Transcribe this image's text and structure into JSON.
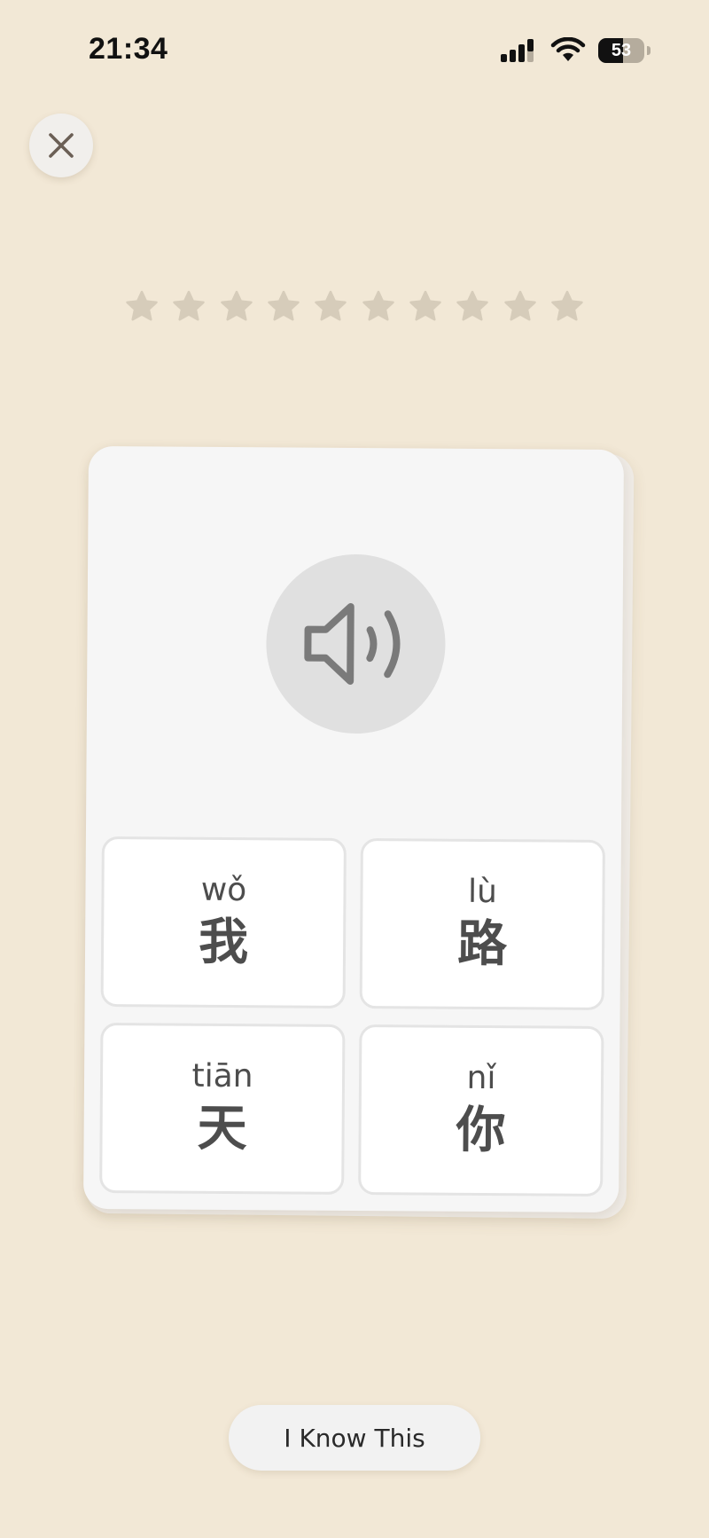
{
  "status_bar": {
    "time": "21:34",
    "battery_level": "53",
    "icons": [
      "signal-icon",
      "wifi-icon",
      "battery-icon"
    ]
  },
  "toolbar": {
    "close_icon": "close-icon"
  },
  "progress": {
    "stars_total": 10,
    "stars_filled": 0,
    "icon": "star-icon"
  },
  "card": {
    "audio_icon": "speaker-icon",
    "options": [
      {
        "pinyin": "wǒ",
        "hanzi": "我"
      },
      {
        "pinyin": "lù",
        "hanzi": "路"
      },
      {
        "pinyin": "tiān",
        "hanzi": "天"
      },
      {
        "pinyin": "nǐ",
        "hanzi": "你"
      }
    ]
  },
  "actions": {
    "know_label": "I Know This"
  },
  "colors": {
    "background": "#f2e8d6",
    "card": "#f6f6f6",
    "star": "#d6ccba",
    "text": "#4d4d4d",
    "icon_gray": "#7a7a7a",
    "close_icon": "#6b5f55"
  }
}
